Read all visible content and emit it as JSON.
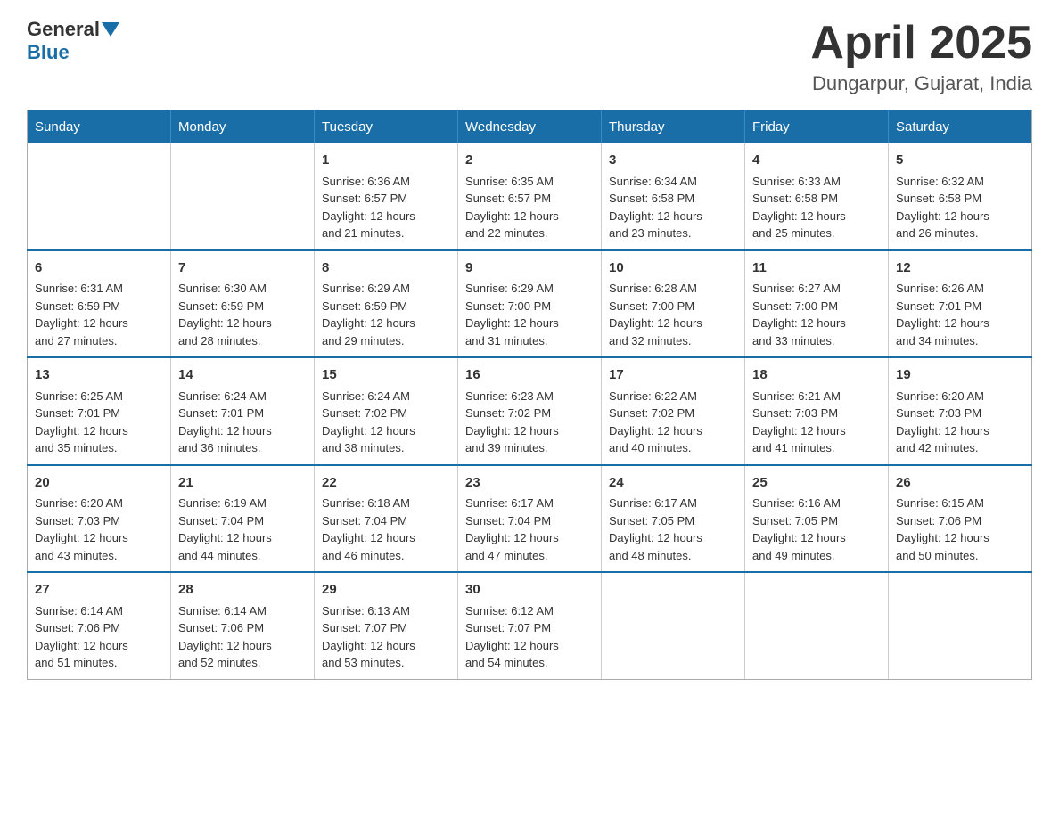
{
  "header": {
    "logo_general": "General",
    "logo_blue": "Blue",
    "month": "April 2025",
    "location": "Dungarpur, Gujarat, India"
  },
  "days_of_week": [
    "Sunday",
    "Monday",
    "Tuesday",
    "Wednesday",
    "Thursday",
    "Friday",
    "Saturday"
  ],
  "weeks": [
    [
      {
        "day": "",
        "info": ""
      },
      {
        "day": "",
        "info": ""
      },
      {
        "day": "1",
        "info": "Sunrise: 6:36 AM\nSunset: 6:57 PM\nDaylight: 12 hours\nand 21 minutes."
      },
      {
        "day": "2",
        "info": "Sunrise: 6:35 AM\nSunset: 6:57 PM\nDaylight: 12 hours\nand 22 minutes."
      },
      {
        "day": "3",
        "info": "Sunrise: 6:34 AM\nSunset: 6:58 PM\nDaylight: 12 hours\nand 23 minutes."
      },
      {
        "day": "4",
        "info": "Sunrise: 6:33 AM\nSunset: 6:58 PM\nDaylight: 12 hours\nand 25 minutes."
      },
      {
        "day": "5",
        "info": "Sunrise: 6:32 AM\nSunset: 6:58 PM\nDaylight: 12 hours\nand 26 minutes."
      }
    ],
    [
      {
        "day": "6",
        "info": "Sunrise: 6:31 AM\nSunset: 6:59 PM\nDaylight: 12 hours\nand 27 minutes."
      },
      {
        "day": "7",
        "info": "Sunrise: 6:30 AM\nSunset: 6:59 PM\nDaylight: 12 hours\nand 28 minutes."
      },
      {
        "day": "8",
        "info": "Sunrise: 6:29 AM\nSunset: 6:59 PM\nDaylight: 12 hours\nand 29 minutes."
      },
      {
        "day": "9",
        "info": "Sunrise: 6:29 AM\nSunset: 7:00 PM\nDaylight: 12 hours\nand 31 minutes."
      },
      {
        "day": "10",
        "info": "Sunrise: 6:28 AM\nSunset: 7:00 PM\nDaylight: 12 hours\nand 32 minutes."
      },
      {
        "day": "11",
        "info": "Sunrise: 6:27 AM\nSunset: 7:00 PM\nDaylight: 12 hours\nand 33 minutes."
      },
      {
        "day": "12",
        "info": "Sunrise: 6:26 AM\nSunset: 7:01 PM\nDaylight: 12 hours\nand 34 minutes."
      }
    ],
    [
      {
        "day": "13",
        "info": "Sunrise: 6:25 AM\nSunset: 7:01 PM\nDaylight: 12 hours\nand 35 minutes."
      },
      {
        "day": "14",
        "info": "Sunrise: 6:24 AM\nSunset: 7:01 PM\nDaylight: 12 hours\nand 36 minutes."
      },
      {
        "day": "15",
        "info": "Sunrise: 6:24 AM\nSunset: 7:02 PM\nDaylight: 12 hours\nand 38 minutes."
      },
      {
        "day": "16",
        "info": "Sunrise: 6:23 AM\nSunset: 7:02 PM\nDaylight: 12 hours\nand 39 minutes."
      },
      {
        "day": "17",
        "info": "Sunrise: 6:22 AM\nSunset: 7:02 PM\nDaylight: 12 hours\nand 40 minutes."
      },
      {
        "day": "18",
        "info": "Sunrise: 6:21 AM\nSunset: 7:03 PM\nDaylight: 12 hours\nand 41 minutes."
      },
      {
        "day": "19",
        "info": "Sunrise: 6:20 AM\nSunset: 7:03 PM\nDaylight: 12 hours\nand 42 minutes."
      }
    ],
    [
      {
        "day": "20",
        "info": "Sunrise: 6:20 AM\nSunset: 7:03 PM\nDaylight: 12 hours\nand 43 minutes."
      },
      {
        "day": "21",
        "info": "Sunrise: 6:19 AM\nSunset: 7:04 PM\nDaylight: 12 hours\nand 44 minutes."
      },
      {
        "day": "22",
        "info": "Sunrise: 6:18 AM\nSunset: 7:04 PM\nDaylight: 12 hours\nand 46 minutes."
      },
      {
        "day": "23",
        "info": "Sunrise: 6:17 AM\nSunset: 7:04 PM\nDaylight: 12 hours\nand 47 minutes."
      },
      {
        "day": "24",
        "info": "Sunrise: 6:17 AM\nSunset: 7:05 PM\nDaylight: 12 hours\nand 48 minutes."
      },
      {
        "day": "25",
        "info": "Sunrise: 6:16 AM\nSunset: 7:05 PM\nDaylight: 12 hours\nand 49 minutes."
      },
      {
        "day": "26",
        "info": "Sunrise: 6:15 AM\nSunset: 7:06 PM\nDaylight: 12 hours\nand 50 minutes."
      }
    ],
    [
      {
        "day": "27",
        "info": "Sunrise: 6:14 AM\nSunset: 7:06 PM\nDaylight: 12 hours\nand 51 minutes."
      },
      {
        "day": "28",
        "info": "Sunrise: 6:14 AM\nSunset: 7:06 PM\nDaylight: 12 hours\nand 52 minutes."
      },
      {
        "day": "29",
        "info": "Sunrise: 6:13 AM\nSunset: 7:07 PM\nDaylight: 12 hours\nand 53 minutes."
      },
      {
        "day": "30",
        "info": "Sunrise: 6:12 AM\nSunset: 7:07 PM\nDaylight: 12 hours\nand 54 minutes."
      },
      {
        "day": "",
        "info": ""
      },
      {
        "day": "",
        "info": ""
      },
      {
        "day": "",
        "info": ""
      }
    ]
  ]
}
